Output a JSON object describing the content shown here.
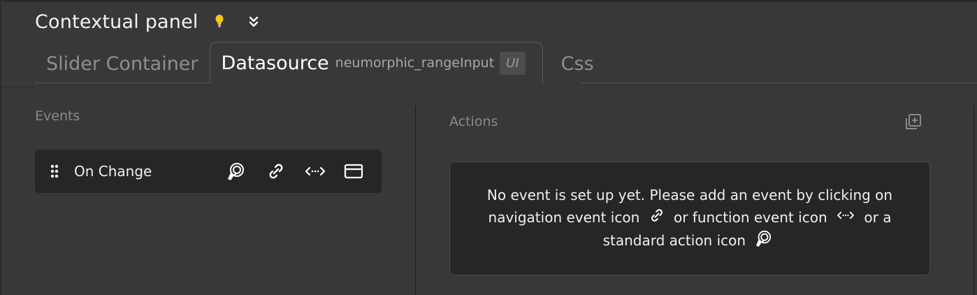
{
  "header": {
    "title": "Contextual panel",
    "icons": [
      "lightbulb-icon",
      "double-chevron-down-icon"
    ],
    "bulb_color": "#f5c518"
  },
  "tabs": [
    {
      "label": "Slider Container",
      "active": false
    },
    {
      "label": "Datasource",
      "subtitle": "neumorphic_rangeInput",
      "badge": "UI",
      "active": true
    },
    {
      "label": "Css",
      "active": false
    }
  ],
  "events": {
    "label": "Events",
    "items": [
      {
        "name": "On Change",
        "icons": [
          "standard-action-icon",
          "link-icon",
          "code-icon",
          "card-icon"
        ]
      }
    ]
  },
  "actions": {
    "label": "Actions",
    "add_icon": "add-copy-icon",
    "empty_line1": "No event is set up yet. Please add an event by clicking on",
    "empty_line2_a": "navigation event icon",
    "empty_line2_b": "or function event icon",
    "empty_line2_c": "or a",
    "empty_line3": "standard action icon"
  }
}
